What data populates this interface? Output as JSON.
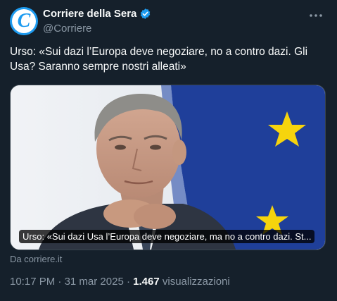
{
  "account": {
    "name": "Corriere della Sera",
    "handle": "@Corriere",
    "avatar_letter": "C",
    "verified": true
  },
  "tweet": {
    "text": "Urso: «Sui dazi l’Europa deve negoziare, no a contro dazi. Gli Usa? Saranno sempre nostri alleati»"
  },
  "card": {
    "title": "Urso: «Sui dazi Usa l’Europa deve negoziare, ma no a contro dazi. St...",
    "source": "Da corriere.it"
  },
  "meta": {
    "time": "10:17 PM",
    "separator": "·",
    "date": "31 mar 2025",
    "views_count": "1.467",
    "views_label": "visualizzazioni"
  },
  "icons": {
    "verified": "verified-badge-icon",
    "more": "more-dots-icon"
  },
  "colors": {
    "background": "#15202b",
    "accent": "#1d9bf0",
    "secondary_text": "#8b98a5",
    "eu_blue": "#1f3f9a",
    "eu_star": "#f6d40d"
  }
}
